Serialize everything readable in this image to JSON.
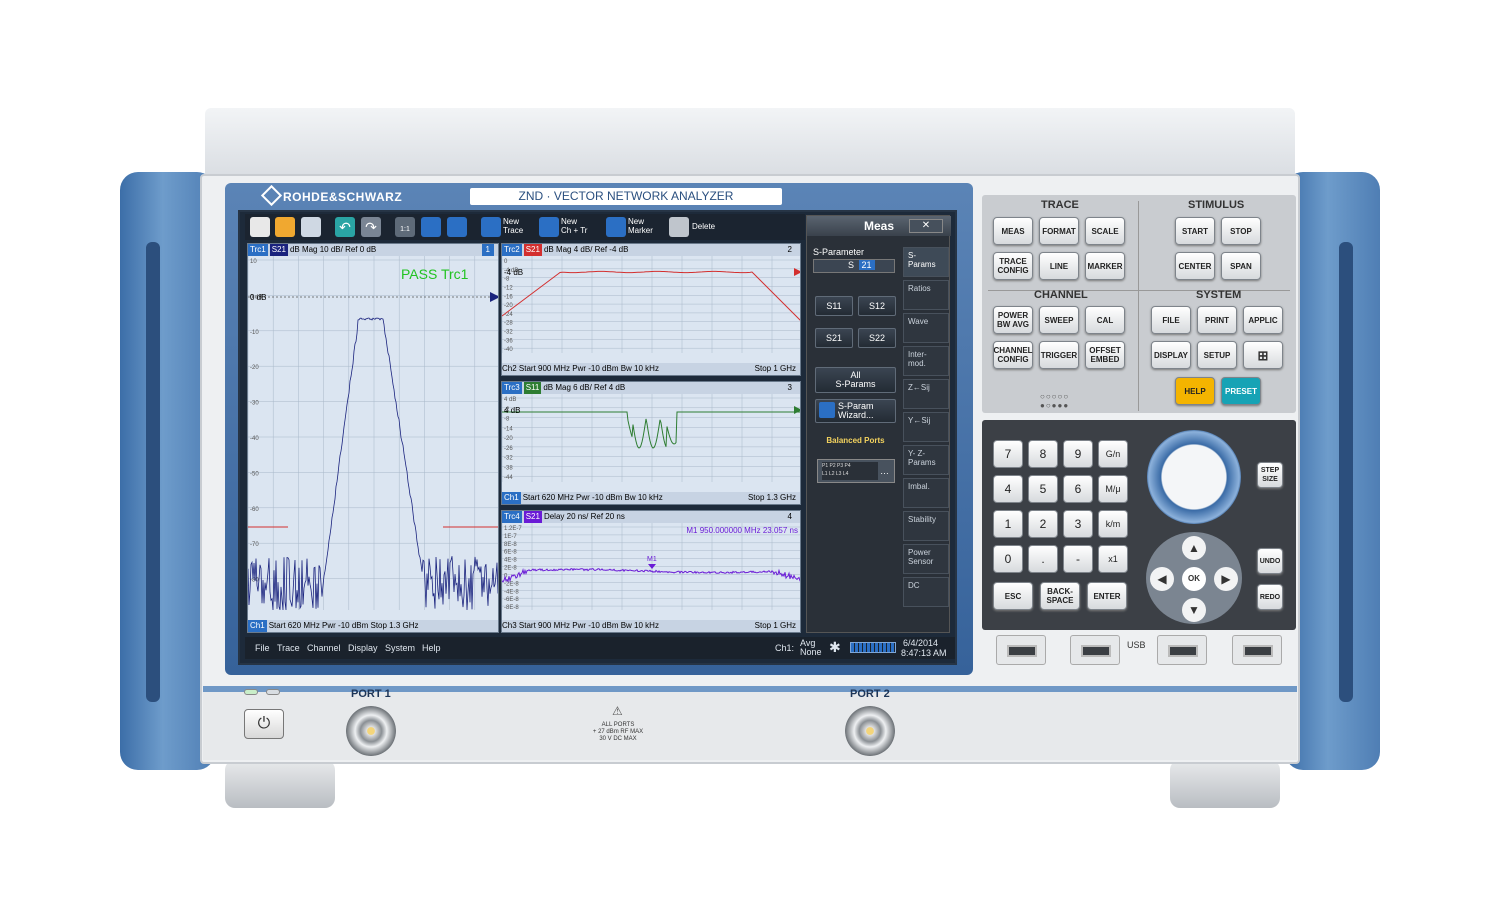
{
  "brand": "ROHDE&SCHWARZ",
  "model": "ZND · VECTOR NETWORK ANALYZER",
  "toolbar": {
    "new_trace": "New\nTrace",
    "new_ch_tr": "New\nCh + Tr",
    "new_marker": "New\nMarker",
    "delete": "Delete",
    "zoom_1to1": "1:1"
  },
  "panes": {
    "trc1": {
      "trace": "Trc1",
      "param": "S21",
      "info": "dB Mag  10 dB/ Ref 0 dB",
      "num": "1",
      "pass": "PASS  Trc1",
      "ref_label": "0 dB",
      "y_ticks": [
        "10",
        "0 dB",
        "-10",
        "-20",
        "-30",
        "-40",
        "-50",
        "-60",
        "-70",
        "-80"
      ],
      "footer_ch": "Ch1",
      "footer": "Start  620 MHz    Pwr  -10 dBm      Stop  1.3 GHz"
    },
    "trc2": {
      "trace": "Trc2",
      "param": "S21",
      "info": "dB Mag  4 dB/ Ref -4 dB",
      "num": "2",
      "ref_label": "-4 dB",
      "y_ticks": [
        "0",
        "-4 dB",
        "-8",
        "-12",
        "-16",
        "-20",
        "-24",
        "-28",
        "-32",
        "-36",
        "-40"
      ],
      "footer": "Ch2  Start  900 MHz  Pwr  -10 dBm  Bw  10 kHz",
      "stop": "Stop  1 GHz"
    },
    "trc3": {
      "trace": "Trc3",
      "param": "S11",
      "info": "dB Mag  6 dB/ Ref 4 dB",
      "num": "3",
      "ref_label": "4 dB",
      "y_ticks": [
        "4 dB",
        "-2",
        "-8",
        "-14",
        "-20",
        "-26",
        "-32",
        "-38",
        "-44"
      ],
      "footer_ch": "Ch1",
      "footer": "Start  620 MHz  Pwr  -10 dBm  Bw  10 kHz",
      "stop": "Stop  1.3 GHz"
    },
    "trc4": {
      "trace": "Trc4",
      "param": "S21",
      "info": "Delay  20 ns/ Ref 20 ns",
      "num": "4",
      "marker_readout": "M1  950.000000 MHz  23.057 ns",
      "marker": "M1",
      "y_ticks": [
        "1.2E-7",
        "1E-7",
        "8E-8",
        "6E-8",
        "4E-8",
        "2E-8",
        "0",
        "-2E-8",
        "-4E-8",
        "-6E-8",
        "-8E-8"
      ],
      "footer": "Ch3  Start  900 MHz  Pwr  -10 dBm  Bw  10 kHz",
      "stop": "Stop  1 GHz"
    }
  },
  "meas_panel": {
    "title": "Meas",
    "close": "✕",
    "sparam_label": "S-Parameter",
    "s_prefix": "S",
    "s_value": "21",
    "s11": "S11",
    "s12": "S12",
    "s21": "S21",
    "s22": "S22",
    "all_sparams": "All\nS-Params",
    "wizard": "S-Param\nWizard...",
    "balanced": "Balanced Ports",
    "ports": [
      "P1",
      "P2",
      "P3",
      "P4",
      "L1",
      "L2",
      "L3",
      "L4"
    ],
    "tabs": [
      "S-\nParams",
      "Ratios",
      "Wave",
      "Inter-\nmod.",
      "Z←Sij",
      "Y←Sij",
      "Y- Z-\nParams",
      "Imbal.",
      "Stability",
      "Power\nSensor",
      "DC"
    ]
  },
  "status": {
    "menus": [
      "File",
      "Trace",
      "Channel",
      "Display",
      "System",
      "Help"
    ],
    "ch": "Ch1:",
    "avg": "Avg\nNone",
    "date": "6/4/2014",
    "time": "8:47:13 AM"
  },
  "hw": {
    "trace_title": "TRACE",
    "stimulus_title": "STIMULUS",
    "channel_title": "CHANNEL",
    "system_title": "SYSTEM",
    "meas": "MEAS",
    "format": "FORMAT",
    "scale": "SCALE",
    "trace_config": "TRACE\nCONFIG",
    "line": "LINE",
    "marker": "MARKER",
    "start": "START",
    "stop": "STOP",
    "center": "CENTER",
    "span": "SPAN",
    "power_bw_avg": "POWER\nBW AVG",
    "sweep": "SWEEP",
    "cal": "CAL",
    "channel_config": "CHANNEL\nCONFIG",
    "trigger": "TRIGGER",
    "offset_embed": "OFFSET\nEMBED",
    "file": "FILE",
    "print": "PRINT",
    "applic": "APPLIC",
    "display": "DISPLAY",
    "setup": "SETUP",
    "help": "HELP",
    "preset": "PRESET",
    "help_color": "#f4b400",
    "preset_color": "#16a3b5",
    "keys": [
      "7",
      "8",
      "9",
      "4",
      "5",
      "6",
      "1",
      "2",
      "3",
      "0",
      ".",
      "-"
    ],
    "units": [
      "G/n",
      "M/μ",
      "k/m",
      "x1"
    ],
    "esc": "ESC",
    "backspace": "BACK-\nSPACE",
    "enter": "ENTER",
    "step_size": "STEP\nSIZE",
    "undo": "UNDO",
    "redo": "REDO",
    "ok": "OK",
    "usb": "USB"
  },
  "ports": {
    "port1": "PORT 1",
    "port2": "PORT 2",
    "warning": "ALL PORTS\n+ 27 dBm RF MAX\n30 V DC MAX"
  },
  "colors": {
    "trace_blue": "#1a237e",
    "trace_red": "#d32f2f",
    "trace_green": "#2e7d32",
    "trace_purple": "#6a1bd6",
    "pass": "#22c322",
    "bezel": "#36629a"
  }
}
